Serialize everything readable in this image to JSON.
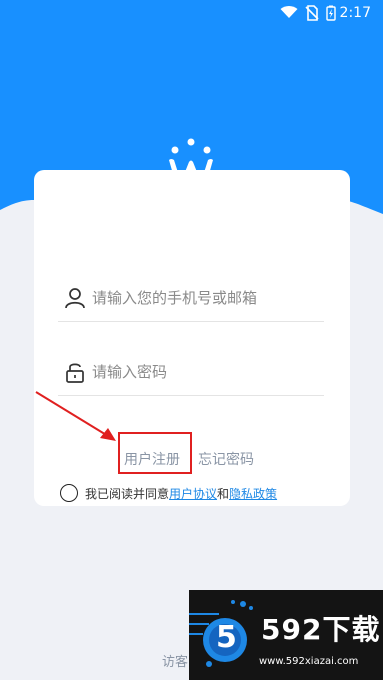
{
  "status_bar": {
    "time": "2:17",
    "icons": [
      "wifi-icon",
      "no-sim-icon",
      "battery-charging-icon"
    ]
  },
  "brand": {
    "logo_icon": "w-smile-logo",
    "primary_color": "#1890ff"
  },
  "login_form": {
    "account_placeholder": "请输入您的手机号或邮箱",
    "account_icon": "user-icon",
    "password_placeholder": "请输入密码",
    "password_icon": "lock-icon",
    "register_label": "用户注册",
    "forgot_label": "忘记密码"
  },
  "agreement": {
    "prefix": "我已阅读并同意",
    "user_agreement": "用户协议",
    "and": "和",
    "privacy_policy": "隐私政策"
  },
  "footer": {
    "visitor_label": "访客"
  },
  "watermark": {
    "logo_mark": "5",
    "brand": "592下载",
    "url": "www.592xiazai.com"
  },
  "annotation": {
    "highlight_color": "#e02020"
  }
}
